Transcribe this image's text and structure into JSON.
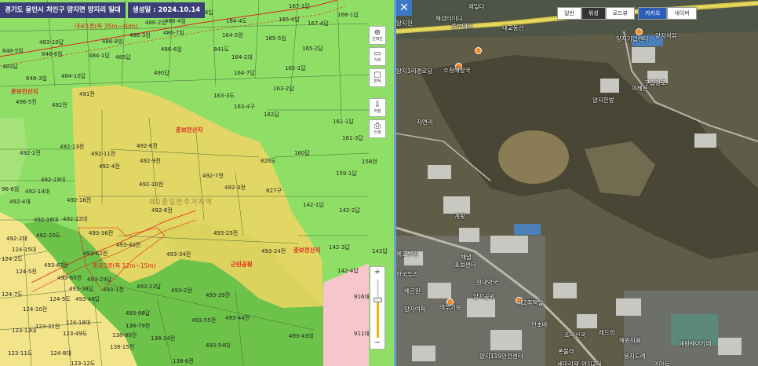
{
  "header": {
    "address": "경기도 용인시 처인구 양지면 양지리 일대",
    "date": "생성일 : 2024.10.14"
  },
  "left_map": {
    "parcels": [
      {
        "t": "488-6입"
      },
      {
        "t": "488-4임"
      },
      {
        "t": "486-2임"
      },
      {
        "t": "486-3임"
      },
      {
        "t": "486-6임"
      },
      {
        "t": "486-7임"
      },
      {
        "t": "486-8임"
      },
      {
        "t": "484-1답"
      },
      {
        "t": "485답"
      },
      {
        "t": "490답"
      },
      {
        "t": "841도"
      },
      {
        "t": "164-2대"
      },
      {
        "t": "164-5임"
      },
      {
        "t": "164-4도"
      },
      {
        "t": "165-4답"
      },
      {
        "t": "165-5임"
      },
      {
        "t": "167-1답"
      },
      {
        "t": "167-4답"
      },
      {
        "t": "168-1답"
      },
      {
        "t": "165-2답"
      },
      {
        "t": "165-1답"
      },
      {
        "t": "164-7답"
      },
      {
        "t": "163-2답"
      },
      {
        "t": "163-3도"
      },
      {
        "t": "163-4구"
      },
      {
        "t": "162답"
      },
      {
        "t": "161-1답"
      },
      {
        "t": "161-3답"
      },
      {
        "t": "160답"
      },
      {
        "t": "158전"
      },
      {
        "t": "159-1답"
      },
      {
        "t": "826도"
      },
      {
        "t": "827구"
      },
      {
        "t": "142-1답"
      },
      {
        "t": "142-2답"
      },
      {
        "t": "142-3답"
      },
      {
        "t": "142-4답"
      },
      {
        "t": "143답"
      },
      {
        "t": "483-10답"
      },
      {
        "t": "848-5임"
      },
      {
        "t": "848-6임"
      },
      {
        "t": "848-3임"
      },
      {
        "t": "483답"
      },
      {
        "t": "484-10답"
      },
      {
        "t": "496-5전"
      },
      {
        "t": "492전"
      },
      {
        "t": "491전"
      },
      {
        "t": "492-13전"
      },
      {
        "t": "492-11전"
      },
      {
        "t": "492-6전"
      },
      {
        "t": "492-4전"
      },
      {
        "t": "492-9전"
      },
      {
        "t": "492-2전"
      },
      {
        "t": "492-19대"
      },
      {
        "t": "492-14대"
      },
      {
        "t": "492-18전"
      },
      {
        "t": "492-7전"
      },
      {
        "t": "492-10전"
      },
      {
        "t": "492-3전"
      },
      {
        "t": "492-8전"
      },
      {
        "t": "492-16대"
      },
      {
        "t": "492-22대"
      },
      {
        "t": "492-20도"
      },
      {
        "t": "493-36전"
      },
      {
        "t": "493-25전"
      },
      {
        "t": "493-40전"
      },
      {
        "t": "493-34전"
      },
      {
        "t": "493-24전"
      },
      {
        "t": "493-62전"
      },
      {
        "t": "493-67전"
      },
      {
        "t": "493-65전"
      },
      {
        "t": "493-29답"
      },
      {
        "t": "493-38답"
      },
      {
        "t": "493-48답"
      },
      {
        "t": "493-1전"
      },
      {
        "t": "493-23답"
      },
      {
        "t": "493-2전"
      },
      {
        "t": "493-39전"
      },
      {
        "t": "493-55전"
      },
      {
        "t": "493-44전"
      },
      {
        "t": "493-66답"
      },
      {
        "t": "138-79전"
      },
      {
        "t": "138-80전"
      },
      {
        "t": "138-14전"
      },
      {
        "t": "493-54대"
      },
      {
        "t": "493-43대"
      },
      {
        "t": "138-6전"
      },
      {
        "t": "124-7도"
      },
      {
        "t": "124-10전"
      },
      {
        "t": "124-5도"
      },
      {
        "t": "124-18대"
      },
      {
        "t": "123-13대"
      },
      {
        "t": "123-49도"
      },
      {
        "t": "123-31전"
      },
      {
        "t": "123-11도"
      },
      {
        "t": "123-12도"
      },
      {
        "t": "124-8대"
      },
      {
        "t": "124-2도"
      },
      {
        "t": "124-5전"
      },
      {
        "t": "916대"
      },
      {
        "t": "911대"
      },
      {
        "t": "96-6임"
      },
      {
        "t": "492-4대"
      },
      {
        "t": "492-2대"
      },
      {
        "t": "124-15대"
      },
      {
        "t": "138-15전"
      }
    ],
    "zones": {
      "forest_top": "준보전산지",
      "forest_center": "준보전산지",
      "forest_right": "준보전산지",
      "park": "근린공원",
      "district": "제2종일반주거지역",
      "road_top": "대로1류(폭 35m~40m)",
      "road_mid": "중로3류(폭 12m~15m)"
    },
    "tools": [
      {
        "icon": "⊕",
        "label": "선택안"
      },
      {
        "icon": "▭",
        "label": "거리"
      },
      {
        "icon": "▢",
        "label": "면적"
      },
      {
        "icon": "⇩",
        "label": "저장"
      },
      {
        "icon": "⎙",
        "label": "인쇄"
      }
    ],
    "zoom": {
      "plus": "+",
      "minus": "−",
      "level_fraction": 0.65
    }
  },
  "right_map": {
    "tabs": {
      "normal": "일반",
      "satellite": "위성",
      "roadview": "로드뷰",
      "kakao": "카카오",
      "naver": "네이버"
    },
    "close_label": "✕",
    "places": [
      {
        "t": "제일다"
      },
      {
        "t": "해성터미니"
      },
      {
        "t": "중부대로"
      },
      {
        "t": "양지천"
      },
      {
        "t": "대교동산"
      },
      {
        "t": "양지기업센터"
      },
      {
        "t": "양지석유"
      },
      {
        "t": "수청해장국"
      },
      {
        "t": "양지1리경로당"
      },
      {
        "t": "이혜은"
      },
      {
        "t": "양지한방"
      },
      {
        "t": "계왕"
      },
      {
        "t": "채널"
      },
      {
        "t": "체드부리"
      },
      {
        "t": "한국우리"
      },
      {
        "t": "포보센터"
      },
      {
        "t": "양지공원"
      },
      {
        "t": "해금원"
      },
      {
        "t": "양지여파"
      },
      {
        "t": "테우기보"
      },
      {
        "t": "제2주택일"
      },
      {
        "t": "민초바"
      },
      {
        "t": "조나산국"
      },
      {
        "t": "해원식품"
      },
      {
        "t": "양지119안전센터"
      },
      {
        "t": "폰볼라"
      },
      {
        "t": "양지2리"
      },
      {
        "t": "세미리재"
      },
      {
        "t": "레드의"
      },
      {
        "t": "용지드래"
      },
      {
        "t": "해원웨아카레"
      },
      {
        "t": "이마트"
      },
      {
        "t": "구립경로"
      },
      {
        "t": "현대약국"
      },
      {
        "t": "자연리"
      }
    ]
  }
}
